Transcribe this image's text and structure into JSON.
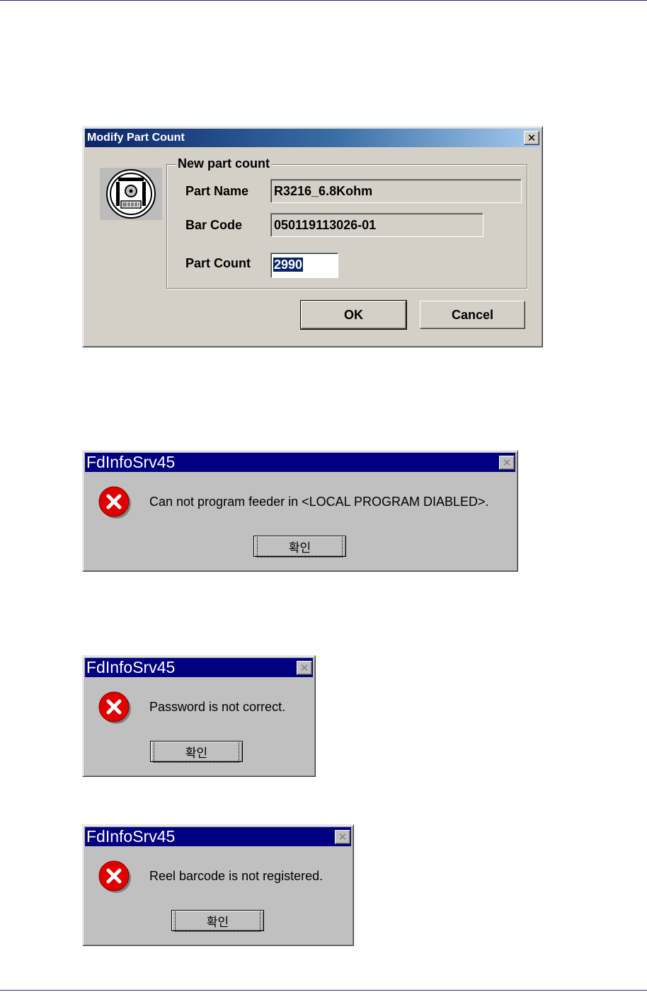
{
  "modify_dialog": {
    "title": "Modify Part Count",
    "close_glyph": "✕",
    "group_title": "New part count",
    "part_name_label": "Part Name",
    "part_name_value": "R3216_6.8Kohm",
    "bar_code_label": "Bar Code",
    "bar_code_value": "050119113026-01",
    "part_count_label": "Part Count",
    "part_count_value": "2990",
    "ok_label": "OK",
    "cancel_label": "Cancel",
    "icon": "reel-icon"
  },
  "message_boxes": [
    {
      "title": "FdInfoSrv45",
      "close_glyph": "✕",
      "message": "Can not program feeder in <LOCAL PROGRAM DIABLED>.",
      "ok_label": "확인",
      "icon": "error-icon"
    },
    {
      "title": "FdInfoSrv45",
      "close_glyph": "✕",
      "message": "Password is not correct.",
      "ok_label": "확인",
      "icon": "error-icon"
    },
    {
      "title": "FdInfoSrv45",
      "close_glyph": "✕",
      "message": "Reel barcode is not registered.",
      "ok_label": "확인",
      "icon": "error-icon"
    }
  ],
  "colors": {
    "title_active": "#0a246a",
    "title_msgbox": "#000080",
    "dialog_face": "#d4d0c8",
    "msgbox_face": "#c0c0c0",
    "error_red": "#e00000"
  }
}
